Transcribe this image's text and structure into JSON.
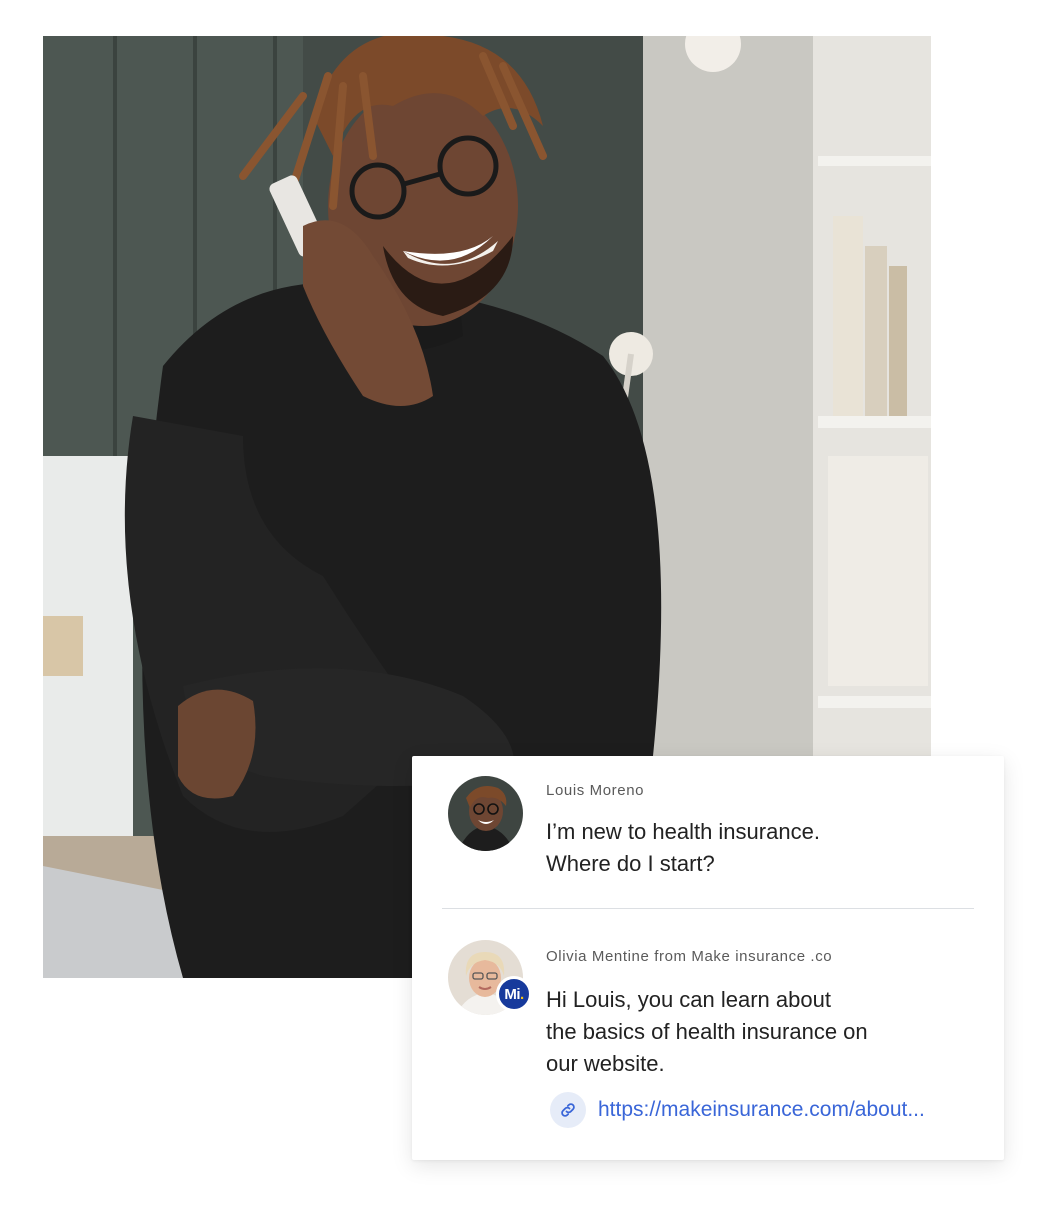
{
  "chat": {
    "message_1": {
      "sender": "Louis Moreno",
      "text": "I’m new to health insurance.\nWhere do I start?"
    },
    "message_2": {
      "sender": "Olivia Mentine from Make insurance .co",
      "text": "Hi Louis, you can learn about\nthe basics of health insurance on\nour website.",
      "badge_text": "Mi",
      "badge_dot": ".",
      "link": "https://makeinsurance.com/about..."
    }
  },
  "colors": {
    "brand": "#173a9c",
    "brand_accent": "#f3c316",
    "link": "#3a66d8"
  },
  "icons": [
    "link-icon"
  ]
}
